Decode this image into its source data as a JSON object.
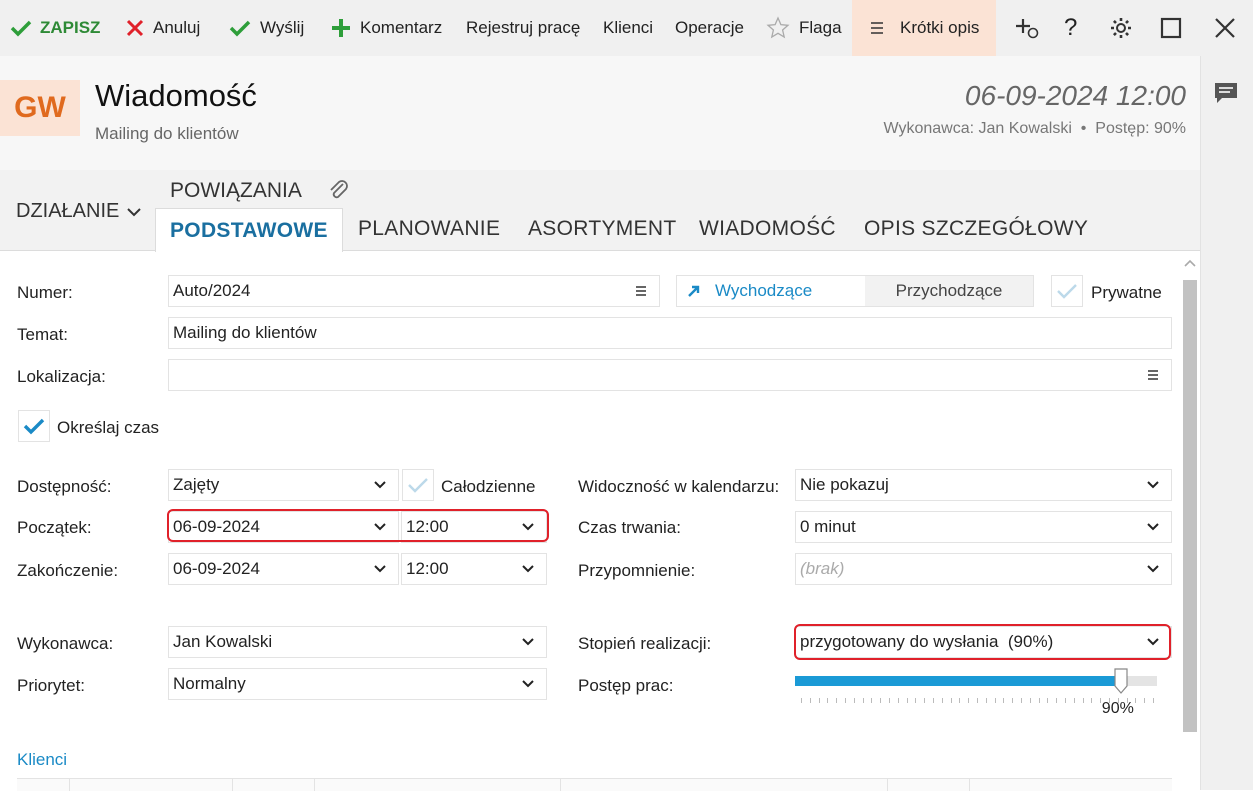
{
  "toolbar": {
    "save": "ZAPISZ",
    "cancel": "Anuluj",
    "send": "Wyślij",
    "comment": "Komentarz",
    "log_work": "Rejestruj pracę",
    "clients": "Klienci",
    "operations": "Operacje",
    "flag": "Flaga",
    "short_desc": "Krótki opis"
  },
  "header": {
    "badge": "GW",
    "title": "Wiadomość",
    "subtitle": "Mailing do klientów",
    "datetime": "06-09-2024 12:00",
    "meta": "Wykonawca: Jan Kowalski  •  Postęp: 90%"
  },
  "tabs": {
    "action": "DZIAŁANIE",
    "links": "POWIĄZANIA",
    "items": [
      "PODSTAWOWE",
      "PLANOWANIE",
      "ASORTYMENT",
      "WIADOMOŚĆ",
      "OPIS SZCZEGÓŁOWY"
    ]
  },
  "form": {
    "number_label": "Numer:",
    "number_value": "Auto/2024",
    "outgoing": "Wychodzące",
    "incoming": "Przychodzące",
    "private": "Prywatne",
    "subject_label": "Temat:",
    "subject_value": "Mailing do klientów",
    "location_label": "Lokalizacja:",
    "location_value": "",
    "specify_time": "Określaj czas",
    "availability_label": "Dostępność:",
    "availability_value": "Zajęty",
    "all_day": "Całodzienne",
    "calendar_visibility_label": "Widoczność w kalendarzu:",
    "calendar_visibility_value": "Nie pokazuj",
    "start_label": "Początek:",
    "start_date": "06-09-2024",
    "start_time": "12:00",
    "duration_label": "Czas trwania:",
    "duration_value": "0 minut",
    "end_label": "Zakończenie:",
    "end_date": "06-09-2024",
    "end_time": "12:00",
    "reminder_label": "Przypomnienie:",
    "reminder_value": "(brak)",
    "executor_label": "Wykonawca:",
    "executor_value": "Jan Kowalski",
    "completion_label": "Stopień realizacji:",
    "completion_value": "przygotowany do wysłania  (90%)",
    "priority_label": "Priorytet:",
    "priority_value": "Normalny",
    "progress_label": "Postęp prac:",
    "progress_value": 0.9,
    "progress_text": "90%",
    "clients_section": "Klienci"
  },
  "colors": {
    "accent_blue": "#1a8ac6",
    "green": "#2e9e3a",
    "red": "#e0212a",
    "badge_bg": "#fbe3d5",
    "badge_text": "#e06a1e"
  }
}
